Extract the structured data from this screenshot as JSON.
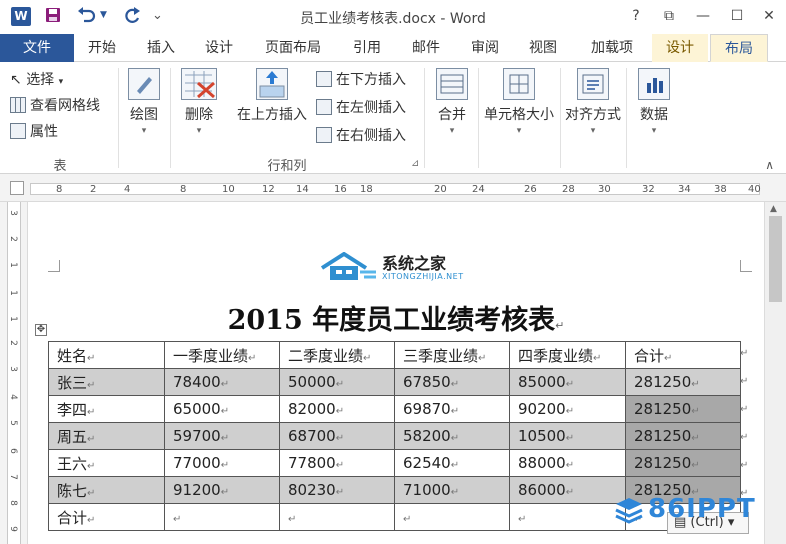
{
  "window": {
    "title": "员工业绩考核表.docx - Word",
    "app_icon": "W",
    "help": "?",
    "restore": "⧉",
    "minimize": "—",
    "maximize": "☐",
    "close": "✕"
  },
  "quick_access": {
    "save_icon": "save-icon",
    "undo_icon": "undo-icon",
    "redo_icon": "redo-icon",
    "customize": "⌄"
  },
  "tabs": {
    "file": "文件",
    "items": [
      "开始",
      "插入",
      "设计",
      "页面布局",
      "引用",
      "邮件",
      "审阅",
      "视图",
      "加载项",
      "设计",
      "布局"
    ],
    "active": "布局"
  },
  "ribbon": {
    "table_group": {
      "label": "表",
      "select": "选择",
      "view_gridlines": "查看网格线",
      "properties": "属性"
    },
    "draw": "绘图",
    "delete": "删除",
    "insert_above": "在上方插入",
    "insert_below": "在下方插入",
    "insert_left": "在左侧插入",
    "insert_right": "在右侧插入",
    "rows_cols_label": "行和列",
    "merge": "合并",
    "cell_size": "单元格大小",
    "alignment": "对齐方式",
    "data": "数据",
    "dialog_launcher": "⊿",
    "collapse": "∧"
  },
  "ruler": {
    "h_numbers": [
      "8",
      "2",
      "4",
      "8",
      "10",
      "12",
      "14",
      "16",
      "18",
      "20",
      "24",
      "26",
      "28",
      "30",
      "32",
      "34",
      "38",
      "40"
    ],
    "v_numbers": [
      "3",
      "2",
      "1",
      "1",
      "1",
      "2",
      "3",
      "4",
      "5",
      "6",
      "7",
      "8",
      "9"
    ]
  },
  "document": {
    "logo_cn": "系统之家",
    "logo_en": "XITONGZHIJIA.NET",
    "title": "2015 年度员工业绩考核表",
    "paragraph_mark": "↵",
    "table_move_handle": "✥",
    "headers": [
      "姓名",
      "一季度业绩",
      "二季度业绩",
      "三季度业绩",
      "四季度业绩",
      "合计"
    ],
    "rows": [
      [
        "张三",
        "78400",
        "50000",
        "67850",
        "85000",
        "281250"
      ],
      [
        "李四",
        "65000",
        "82000",
        "69870",
        "90200",
        "281250"
      ],
      [
        "周五",
        "59700",
        "68700",
        "58200",
        "10500",
        "281250"
      ],
      [
        "王六",
        "77000",
        "77800",
        "62540",
        "88000",
        "281250"
      ],
      [
        "陈七",
        "91200",
        "80230",
        "71000",
        "86000",
        "281250"
      ],
      [
        "合计",
        "",
        "",
        "",
        "",
        ""
      ]
    ],
    "paste_options": "(Ctrl) ▾"
  },
  "watermark": "86IPPT",
  "colors": {
    "word_blue": "#2b579a",
    "context_tab": "#fdf4d6",
    "selection_gray": "#cfcfcf",
    "logo_blue": "#2f8fd0"
  }
}
